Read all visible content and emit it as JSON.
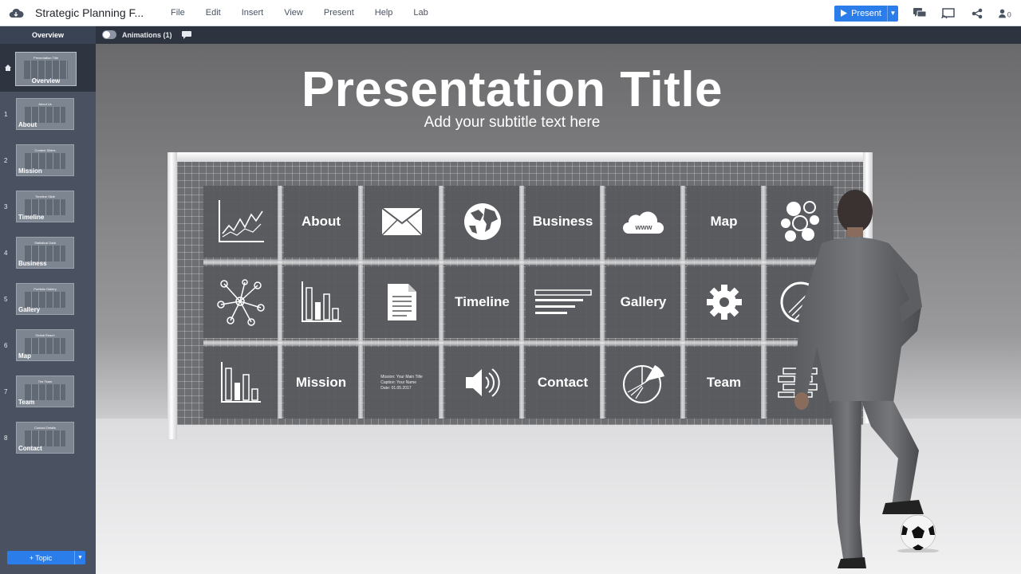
{
  "app": {
    "doc_title": "Strategic Planning F...",
    "menu": [
      "File",
      "Edit",
      "Insert",
      "View",
      "Present",
      "Help",
      "Lab"
    ],
    "present_label": "Present"
  },
  "subbar": {
    "overview_tab": "Overview",
    "animations_label": "Animations (1)"
  },
  "sidebar": {
    "overview": {
      "label": "Overview",
      "thumb_title": "Presentation Title"
    },
    "slides": [
      {
        "num": "1",
        "label": "About",
        "thumb_title": "About Us"
      },
      {
        "num": "2",
        "label": "Mission",
        "thumb_title": "Content Slides"
      },
      {
        "num": "3",
        "label": "Timeline",
        "thumb_title": "Timeline Slide"
      },
      {
        "num": "4",
        "label": "Business",
        "thumb_title": "Statistical Data"
      },
      {
        "num": "5",
        "label": "Gallery",
        "thumb_title": "Portfolio Gallery"
      },
      {
        "num": "6",
        "label": "Map",
        "thumb_title": "Global Reach"
      },
      {
        "num": "7",
        "label": "Team",
        "thumb_title": "The Team"
      },
      {
        "num": "8",
        "label": "Contact",
        "thumb_title": "Contact Details"
      }
    ],
    "topic_label": "Topic"
  },
  "slide": {
    "title": "Presentation Title",
    "subtitle": "Add your subtitle text here",
    "cells": {
      "about": "About",
      "business": "Business",
      "map": "Map",
      "timeline": "Timeline",
      "gallery": "Gallery",
      "mission": "Mission",
      "contact": "Contact",
      "team": "Team",
      "www": "www",
      "form_lines": [
        "Mission: Your Main Title",
        "Caption: Your Name",
        "Date: 01.05.2017"
      ]
    }
  },
  "colors": {
    "accent": "#2b7de9",
    "sidebar_bg": "#4a5262",
    "topbar_dark": "#2d3440"
  },
  "icons": [
    "cloud-logo-icon",
    "play-icon",
    "chat-icon",
    "cast-icon",
    "share-icon",
    "user-count-icon",
    "comment-icon",
    "home-icon",
    "line-chart-icon",
    "envelope-icon",
    "globe-icon",
    "www-cloud-icon",
    "bubbles-icon",
    "network-icon",
    "bar-chart-icon",
    "document-icon",
    "list-lines-icon",
    "gear-icon",
    "pie-chart-icon",
    "speaker-icon",
    "bricks-icon"
  ]
}
